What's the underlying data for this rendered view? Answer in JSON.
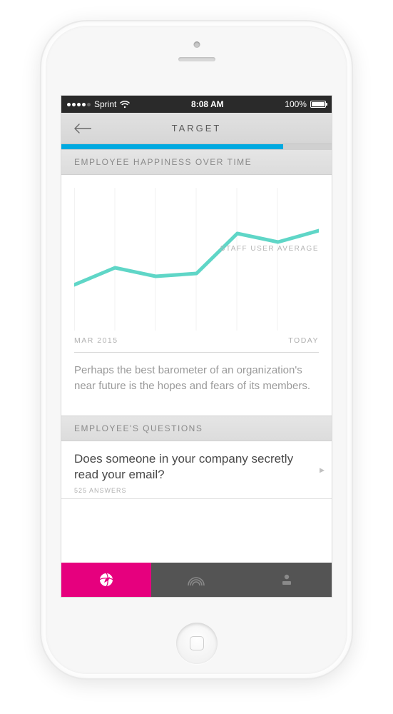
{
  "status": {
    "carrier": "Sprint",
    "time": "8:08 AM",
    "battery_pct": "100%"
  },
  "nav": {
    "title": "TARGET"
  },
  "progress": {
    "pct": 82
  },
  "sections": {
    "chart_header": "EMPLOYEE HAPPINESS OVER TIME",
    "questions_header": "EMPLOYEE'S QUESTIONS"
  },
  "chart": {
    "series_label": "STAFF USER AVERAGE",
    "x_start": "MAR 2015",
    "x_end": "TODAY",
    "caption": "Perhaps the best barometer of an organization's near future is the hopes and fears of its members."
  },
  "question": {
    "title": "Does someone in your company secretly read your email?",
    "meta": "525 ANSWERS"
  },
  "chart_data": {
    "type": "line",
    "title": "EMPLOYEE HAPPINESS OVER TIME",
    "xlabel": "",
    "ylabel": "",
    "x_start_label": "MAR 2015",
    "x_end_label": "TODAY",
    "ylim": [
      0,
      100
    ],
    "series": [
      {
        "name": "STAFF USER AVERAGE",
        "x": [
          0,
          1,
          2,
          3,
          4,
          5,
          6
        ],
        "values": [
          32,
          44,
          38,
          40,
          68,
          62,
          70
        ]
      }
    ]
  }
}
